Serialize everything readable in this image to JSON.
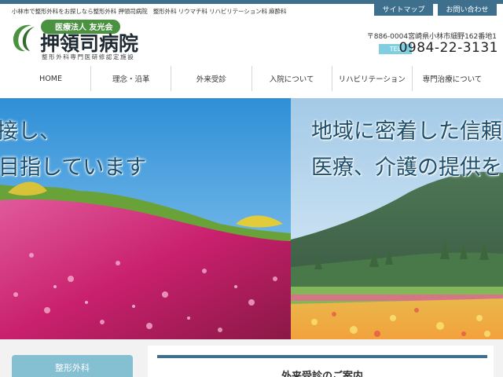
{
  "header": {
    "tagline": "小林市で整形外科をお探しなら整形外科 押領司病院　整形外科 リウマチ科 リハビリテーション科 麻酔科",
    "top_links": [
      "サイトマップ",
      "お問い合わせ"
    ],
    "logo": {
      "organization": "医療法人 友光会",
      "name": "押領司病院",
      "subtitle": "整形外科専門医研修認定施設"
    },
    "address": "〒886-0004宮崎県小林市細野162番地1",
    "tel_label": "TEL",
    "tel_number": "0984-22-3131"
  },
  "nav": {
    "items": [
      "HOME",
      "理念・沿革",
      "外来受診",
      "入院について",
      "リハビリテーション",
      "専門治療について"
    ]
  },
  "hero": {
    "left_line1": "接し、",
    "left_line2": "目指しています",
    "right_line1": "地域に密着した信頼",
    "right_line2": "医療、介護の提供を"
  },
  "sidebar": {
    "box_title": "整形外科"
  },
  "main": {
    "heading": "外来受診のご案内"
  },
  "colors": {
    "accent": "#3e6f8c",
    "logo_green": "#4a9140",
    "tel_badge": "#7fcfe0",
    "side_box": "#84bfd2"
  }
}
